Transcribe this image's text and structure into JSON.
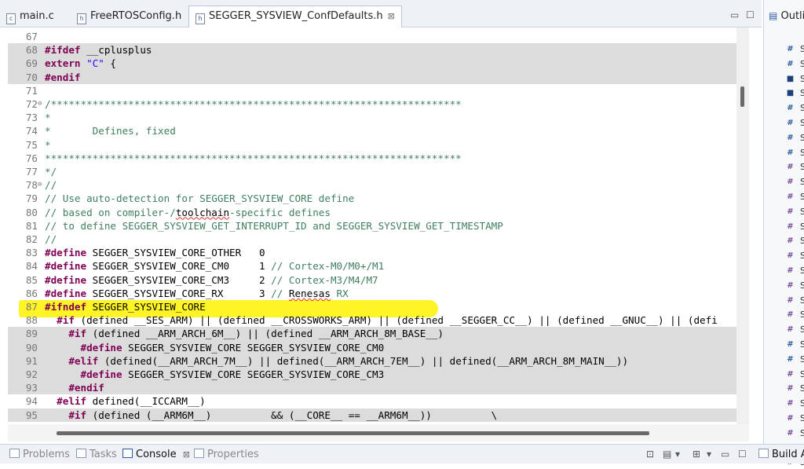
{
  "tabs": [
    {
      "label": "main.c",
      "active": false,
      "icon": "c-file-icon"
    },
    {
      "label": "FreeRTOSConfig.h",
      "active": false,
      "icon": "h-file-icon"
    },
    {
      "label": "SEGGER_SYSVIEW_ConfDefaults.h",
      "active": true,
      "icon": "h-file-icon",
      "close": "⊠"
    }
  ],
  "window_buttons": {
    "minimize": "▭",
    "maximize": "☐"
  },
  "outline": {
    "title": "Outli",
    "items": [
      {
        "icon": "#",
        "kind": "def",
        "text": "S"
      },
      {
        "icon": "#",
        "kind": "def",
        "text": "S"
      },
      {
        "icon": "■",
        "kind": "inc",
        "text": "S"
      },
      {
        "icon": "■",
        "kind": "inc",
        "text": "S"
      },
      {
        "icon": "#",
        "kind": "def",
        "text": "S"
      },
      {
        "icon": "#",
        "kind": "def",
        "text": "S"
      },
      {
        "icon": "#",
        "kind": "def",
        "text": "S"
      },
      {
        "icon": "#",
        "kind": "def",
        "text": "S"
      },
      {
        "icon": "#",
        "kind": "und",
        "text": "S"
      },
      {
        "icon": "#",
        "kind": "und",
        "text": "S"
      },
      {
        "icon": "#",
        "kind": "und",
        "text": "S"
      },
      {
        "icon": "#",
        "kind": "und",
        "text": "S"
      },
      {
        "icon": "#",
        "kind": "und",
        "text": "S"
      },
      {
        "icon": "#",
        "kind": "und",
        "text": "S"
      },
      {
        "icon": "#",
        "kind": "und",
        "text": "S"
      },
      {
        "icon": "#",
        "kind": "und",
        "text": "S"
      },
      {
        "icon": "#",
        "kind": "und",
        "text": "S"
      },
      {
        "icon": "#",
        "kind": "und",
        "text": "S"
      },
      {
        "icon": "#",
        "kind": "und",
        "text": "S"
      },
      {
        "icon": "#",
        "kind": "und",
        "text": "S"
      },
      {
        "icon": "#",
        "kind": "def",
        "text": "S"
      },
      {
        "icon": "#",
        "kind": "def",
        "text": "S"
      },
      {
        "icon": "#",
        "kind": "und",
        "text": "S"
      },
      {
        "icon": "#",
        "kind": "und",
        "text": "S"
      },
      {
        "icon": "#",
        "kind": "und",
        "text": "S"
      },
      {
        "icon": "#",
        "kind": "und",
        "text": "S"
      },
      {
        "icon": "#",
        "kind": "und",
        "text": "S"
      },
      {
        "icon": "#",
        "kind": "und",
        "text": "S"
      },
      {
        "icon": "#",
        "kind": "und",
        "text": "S"
      }
    ]
  },
  "code_lines": [
    {
      "n": "67",
      "fold": "",
      "shade": false,
      "parts": []
    },
    {
      "n": "68",
      "fold": "",
      "shade": true,
      "parts": [
        [
          "kw",
          "#ifdef"
        ],
        [
          "t",
          " __cplusplus"
        ]
      ]
    },
    {
      "n": "69",
      "fold": "",
      "shade": true,
      "parts": [
        [
          "kw",
          "extern"
        ],
        [
          "t",
          " "
        ],
        [
          "str",
          "\"C\""
        ],
        [
          "t",
          " {"
        ]
      ]
    },
    {
      "n": "70",
      "fold": "",
      "shade": true,
      "parts": [
        [
          "kw",
          "#endif"
        ]
      ]
    },
    {
      "n": "71",
      "fold": "",
      "shade": false,
      "parts": []
    },
    {
      "n": "72",
      "fold": "⊖",
      "shade": false,
      "parts": [
        [
          "cm",
          "/*********************************************************************"
        ]
      ]
    },
    {
      "n": "73",
      "fold": "",
      "shade": false,
      "parts": [
        [
          "cm",
          "*"
        ]
      ]
    },
    {
      "n": "74",
      "fold": "",
      "shade": false,
      "parts": [
        [
          "cm",
          "*       Defines, fixed"
        ]
      ]
    },
    {
      "n": "75",
      "fold": "",
      "shade": false,
      "parts": [
        [
          "cm",
          "*"
        ]
      ]
    },
    {
      "n": "76",
      "fold": "",
      "shade": false,
      "parts": [
        [
          "cm",
          "**********************************************************************"
        ]
      ]
    },
    {
      "n": "77",
      "fold": "",
      "shade": false,
      "parts": [
        [
          "cm",
          "*/"
        ]
      ]
    },
    {
      "n": "78",
      "fold": "⊖",
      "shade": false,
      "parts": [
        [
          "cm",
          "//"
        ]
      ]
    },
    {
      "n": "79",
      "fold": "",
      "shade": false,
      "parts": [
        [
          "cm",
          "// Use auto-detection for SEGGER_SYSVIEW_CORE define"
        ]
      ]
    },
    {
      "n": "80",
      "fold": "",
      "shade": false,
      "parts": [
        [
          "cm",
          "// based on compiler-/"
        ],
        [
          "sq",
          "toolchain"
        ],
        [
          "cm",
          "-specific defines"
        ]
      ]
    },
    {
      "n": "81",
      "fold": "",
      "shade": false,
      "parts": [
        [
          "cm",
          "// to define SEGGER_SYSVIEW_GET_INTERRUPT_ID and SEGGER_SYSVIEW_GET_TIMESTAMP"
        ]
      ]
    },
    {
      "n": "82",
      "fold": "",
      "shade": false,
      "parts": [
        [
          "cm",
          "//"
        ]
      ]
    },
    {
      "n": "83",
      "fold": "",
      "shade": false,
      "parts": [
        [
          "kw",
          "#define"
        ],
        [
          "t",
          " SEGGER_SYSVIEW_CORE_OTHER   0"
        ]
      ]
    },
    {
      "n": "84",
      "fold": "",
      "shade": false,
      "parts": [
        [
          "kw",
          "#define"
        ],
        [
          "t",
          " SEGGER_SYSVIEW_CORE_CM0     1 "
        ],
        [
          "cm",
          "// Cortex-M0/M0+/M1"
        ]
      ]
    },
    {
      "n": "85",
      "fold": "",
      "shade": false,
      "parts": [
        [
          "kw",
          "#define"
        ],
        [
          "t",
          " SEGGER_SYSVIEW_CORE_CM3     2 "
        ],
        [
          "cm",
          "// Cortex-M3/M4/M7"
        ]
      ]
    },
    {
      "n": "86",
      "fold": "",
      "shade": false,
      "parts": [
        [
          "kw",
          "#define"
        ],
        [
          "t",
          " SEGGER_SYSVIEW_CORE_RX      3 "
        ],
        [
          "cm",
          "// "
        ],
        [
          "sq",
          "Renesas"
        ],
        [
          "cm",
          " RX"
        ]
      ]
    },
    {
      "n": "87",
      "fold": "",
      "shade": false,
      "parts": [
        [
          "kw",
          "#ifndef"
        ],
        [
          "t",
          " SEGGER_SYSVIEW_CORE"
        ]
      ]
    },
    {
      "n": "88",
      "fold": "",
      "shade": false,
      "parts": [
        [
          "t",
          "  "
        ],
        [
          "kw",
          "#if"
        ],
        [
          "t",
          " (defined __SES_ARM) || (defined __CROSSWORKS_ARM) || (defined __SEGGER_CC__) || (defined __GNUC__) || (defi"
        ]
      ]
    },
    {
      "n": "89",
      "fold": "",
      "shade": true,
      "parts": [
        [
          "t",
          "    "
        ],
        [
          "kw",
          "#if"
        ],
        [
          "t",
          " (defined __ARM_ARCH_6M__) || (defined __ARM_ARCH_8M_BASE__)"
        ]
      ]
    },
    {
      "n": "90",
      "fold": "",
      "shade": true,
      "parts": [
        [
          "t",
          "      "
        ],
        [
          "kw",
          "#define"
        ],
        [
          "t",
          " SEGGER_SYSVIEW_CORE SEGGER_SYSVIEW_CORE_CM0"
        ]
      ]
    },
    {
      "n": "91",
      "fold": "",
      "shade": true,
      "parts": [
        [
          "t",
          "    "
        ],
        [
          "kw",
          "#elif"
        ],
        [
          "t",
          " (defined(__ARM_ARCH_7M__) || defined(__ARM_ARCH_7EM__) || defined(__ARM_ARCH_8M_MAIN__))"
        ]
      ]
    },
    {
      "n": "92",
      "fold": "",
      "shade": true,
      "parts": [
        [
          "t",
          "      "
        ],
        [
          "kw",
          "#define"
        ],
        [
          "t",
          " SEGGER_SYSVIEW_CORE SEGGER_SYSVIEW_CORE_CM3"
        ]
      ]
    },
    {
      "n": "93",
      "fold": "",
      "shade": true,
      "parts": [
        [
          "t",
          "    "
        ],
        [
          "kw",
          "#endif"
        ]
      ]
    },
    {
      "n": "94",
      "fold": "",
      "shade": false,
      "parts": [
        [
          "t",
          "  "
        ],
        [
          "kw",
          "#elif"
        ],
        [
          "t",
          " defined(__ICCARM__)"
        ]
      ]
    },
    {
      "n": "95",
      "fold": "",
      "shade": true,
      "parts": [
        [
          "t",
          "    "
        ],
        [
          "kw",
          "#if"
        ],
        [
          "t",
          " (defined (__ARM6M__)          && (__CORE__ == __ARM6M__))          \\"
        ]
      ]
    }
  ],
  "bottom_tabs": [
    {
      "label": "Problems",
      "active": false
    },
    {
      "label": "Tasks",
      "active": false
    },
    {
      "label": "Console",
      "active": true,
      "close": "⊠"
    },
    {
      "label": "Properties",
      "active": false
    }
  ],
  "build_tab": {
    "label": "Build A"
  },
  "toolbar_icons": {
    "pin": "⊡",
    "display": "▤",
    "dropdown": "▾",
    "open": "⊞",
    "menu": "▾",
    "minimize": "▭",
    "maximize": "☐"
  }
}
